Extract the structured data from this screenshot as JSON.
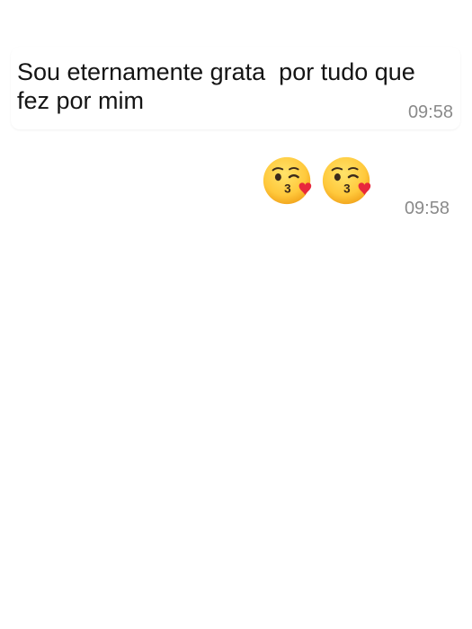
{
  "messages": [
    {
      "text": "Sou eternamente grata  por tudo que fez por mim",
      "time": "09:58"
    },
    {
      "emojis": [
        "kissing-face-with-heart-icon",
        "kissing-face-with-heart-icon"
      ],
      "time": "09:58"
    }
  ],
  "colors": {
    "background": "#ffffff",
    "text": "#141414",
    "timestamp": "#8a8a8a",
    "emoji_face": "#ffc93c",
    "emoji_heart": "#e8283c"
  }
}
